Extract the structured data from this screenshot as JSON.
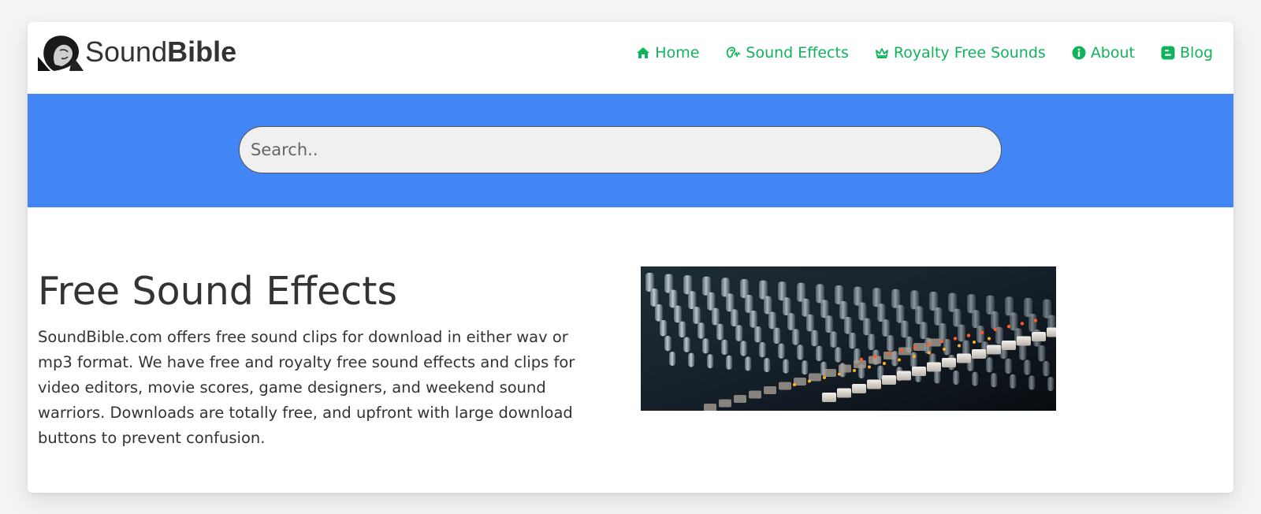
{
  "logo": {
    "text_light": "Sound",
    "text_bold": "Bible"
  },
  "nav": {
    "items": [
      {
        "label": "Home",
        "icon": "home-icon"
      },
      {
        "label": "Sound Effects",
        "icon": "ear-icon"
      },
      {
        "label": "Royalty Free Sounds",
        "icon": "crown-icon"
      },
      {
        "label": "About",
        "icon": "info-icon"
      },
      {
        "label": "Blog",
        "icon": "blogger-icon"
      }
    ]
  },
  "search": {
    "placeholder": "Search..",
    "value": ""
  },
  "main": {
    "title": "Free Sound Effects",
    "description": "SoundBible.com offers free sound clips for download in either wav or mp3 format. We have free and royalty free sound effects and clips for video editors, movie scores, game designers, and weekend sound warriors. Downloads are totally free, and upfront with large download buttons to prevent confusion."
  },
  "colors": {
    "accent_green": "#11b35a",
    "search_band_blue": "#4285f4",
    "text_dark": "#333333"
  }
}
